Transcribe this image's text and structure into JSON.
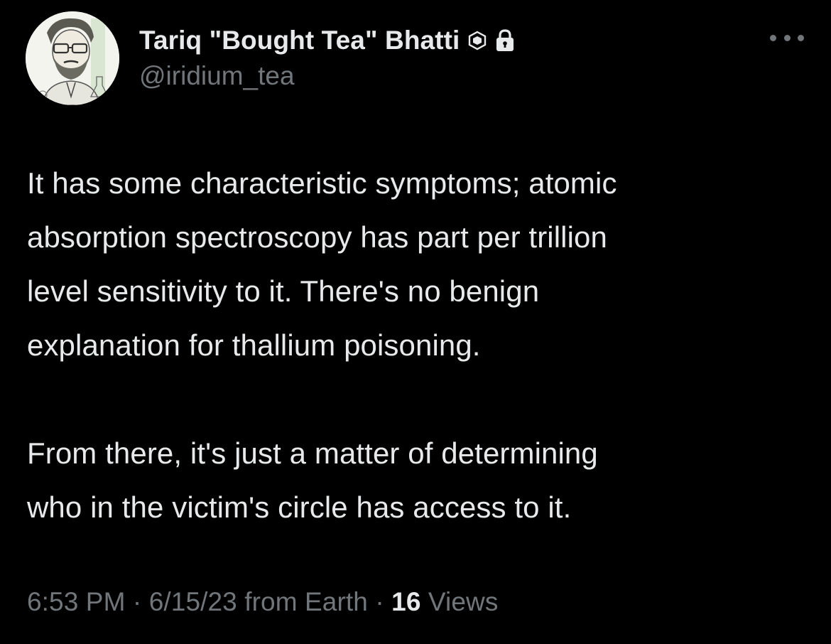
{
  "author": {
    "display_name": "Tariq \"Bought Tea\" Bhatti",
    "handle": "@iridium_tea",
    "avatar_icon": "caricature-avatar",
    "badges": [
      "hexagon-badge-icon",
      "lock-icon"
    ]
  },
  "tweet": {
    "lines_paragraph_1": [
      "It has some characteristic symptoms; atomic",
      "absorption spectroscopy has part per trillion",
      "level sensitivity to it. There's no benign",
      "explanation for thallium poisoning."
    ],
    "lines_paragraph_2": [
      "From there, it's just a matter of determining",
      "who in the victim's circle has access to it."
    ]
  },
  "meta": {
    "time": "6:53 PM",
    "separator": "·",
    "date": "6/15/23",
    "source": "from Earth",
    "views_count": "16",
    "views_label": "Views"
  },
  "colors": {
    "background": "#000000",
    "primary_text": "#e7e9ea",
    "secondary_text": "#71767b"
  }
}
